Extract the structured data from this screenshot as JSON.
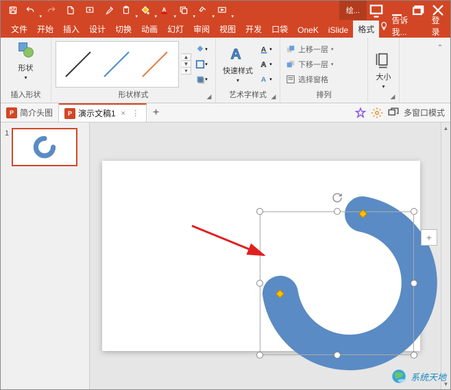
{
  "titlebar": {
    "context_tab": "绘..."
  },
  "tabs": {
    "file": "文件",
    "home": "开始",
    "insert": "插入",
    "design": "设计",
    "trans": "切换",
    "anim": "动画",
    "slide": "幻灯",
    "review": "审阅",
    "view": "视图",
    "dev": "开发",
    "pocket": "口袋",
    "onek": "OneK",
    "islide": "iSlide",
    "format": "格式",
    "tellme": "告诉我...",
    "login": "登录"
  },
  "ribbon": {
    "shapes": "形状",
    "insert_shape": "插入形状",
    "shape_style": "形状样式",
    "quick_style": "快速样式",
    "wordart": "艺术字样式",
    "bring_fwd": "上移一层",
    "send_back": "下移一层",
    "sel_pane": "选择窗格",
    "arrange": "排列",
    "size": "大小"
  },
  "doctabs": {
    "tab1": "简介头图",
    "tab2": "演示文稿1",
    "multi": "多窗口模式"
  },
  "thumb": {
    "n1": "1"
  },
  "watermark": "系统天地"
}
